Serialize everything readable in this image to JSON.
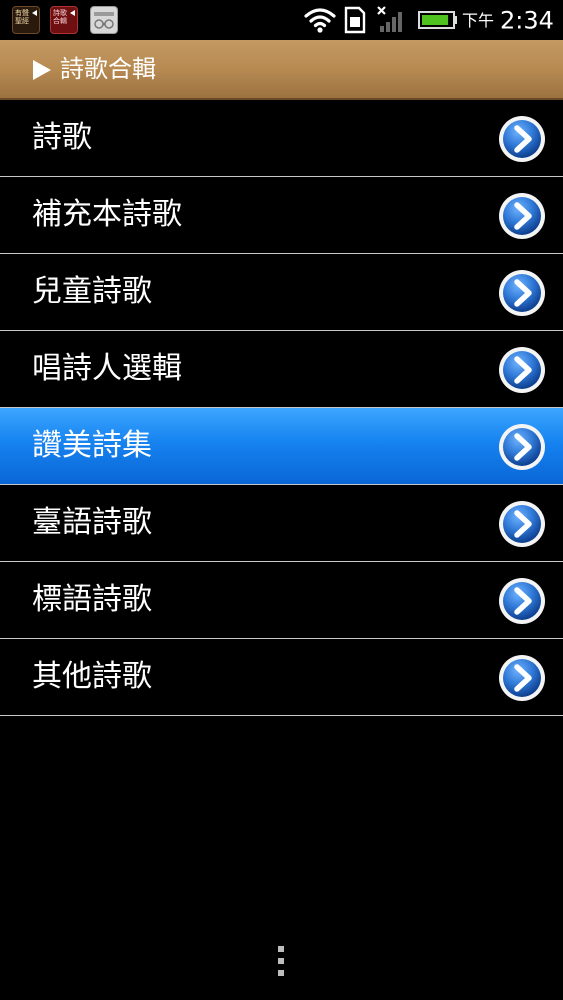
{
  "status_bar": {
    "notifications": [
      {
        "icon": "app-notification-icon",
        "label": "有聲\n聖經"
      },
      {
        "icon": "app-notification-icon",
        "label": "詩歌\n合輯"
      },
      {
        "icon": "music-player-notification-icon",
        "label": ""
      }
    ],
    "time_ampm": "下午",
    "time": "2:34",
    "icons": [
      "wifi-icon",
      "sim-card-icon",
      "no-signal-icon",
      "battery-icon"
    ],
    "battery_level": 0.9
  },
  "header": {
    "title": "詩歌合輯",
    "icon": "play-arrow-icon"
  },
  "menu": {
    "items": [
      {
        "label": "詩歌",
        "selected": false
      },
      {
        "label": "補充本詩歌",
        "selected": false
      },
      {
        "label": "兒童詩歌",
        "selected": false
      },
      {
        "label": "唱詩人選輯",
        "selected": false
      },
      {
        "label": "讚美詩集",
        "selected": true
      },
      {
        "label": "臺語詩歌",
        "selected": false
      },
      {
        "label": "標語詩歌",
        "selected": false
      },
      {
        "label": "其他詩歌",
        "selected": false
      }
    ],
    "item_icon": "chevron-right-circle-icon"
  },
  "bottom": {
    "icon": "overflow-menu-icon"
  },
  "colors": {
    "header_bg": "#b78a52",
    "selected_bg": "#1683f0",
    "go_icon_blue": "#2f78d6",
    "background": "#000000",
    "divider": "#c8c8c8"
  }
}
